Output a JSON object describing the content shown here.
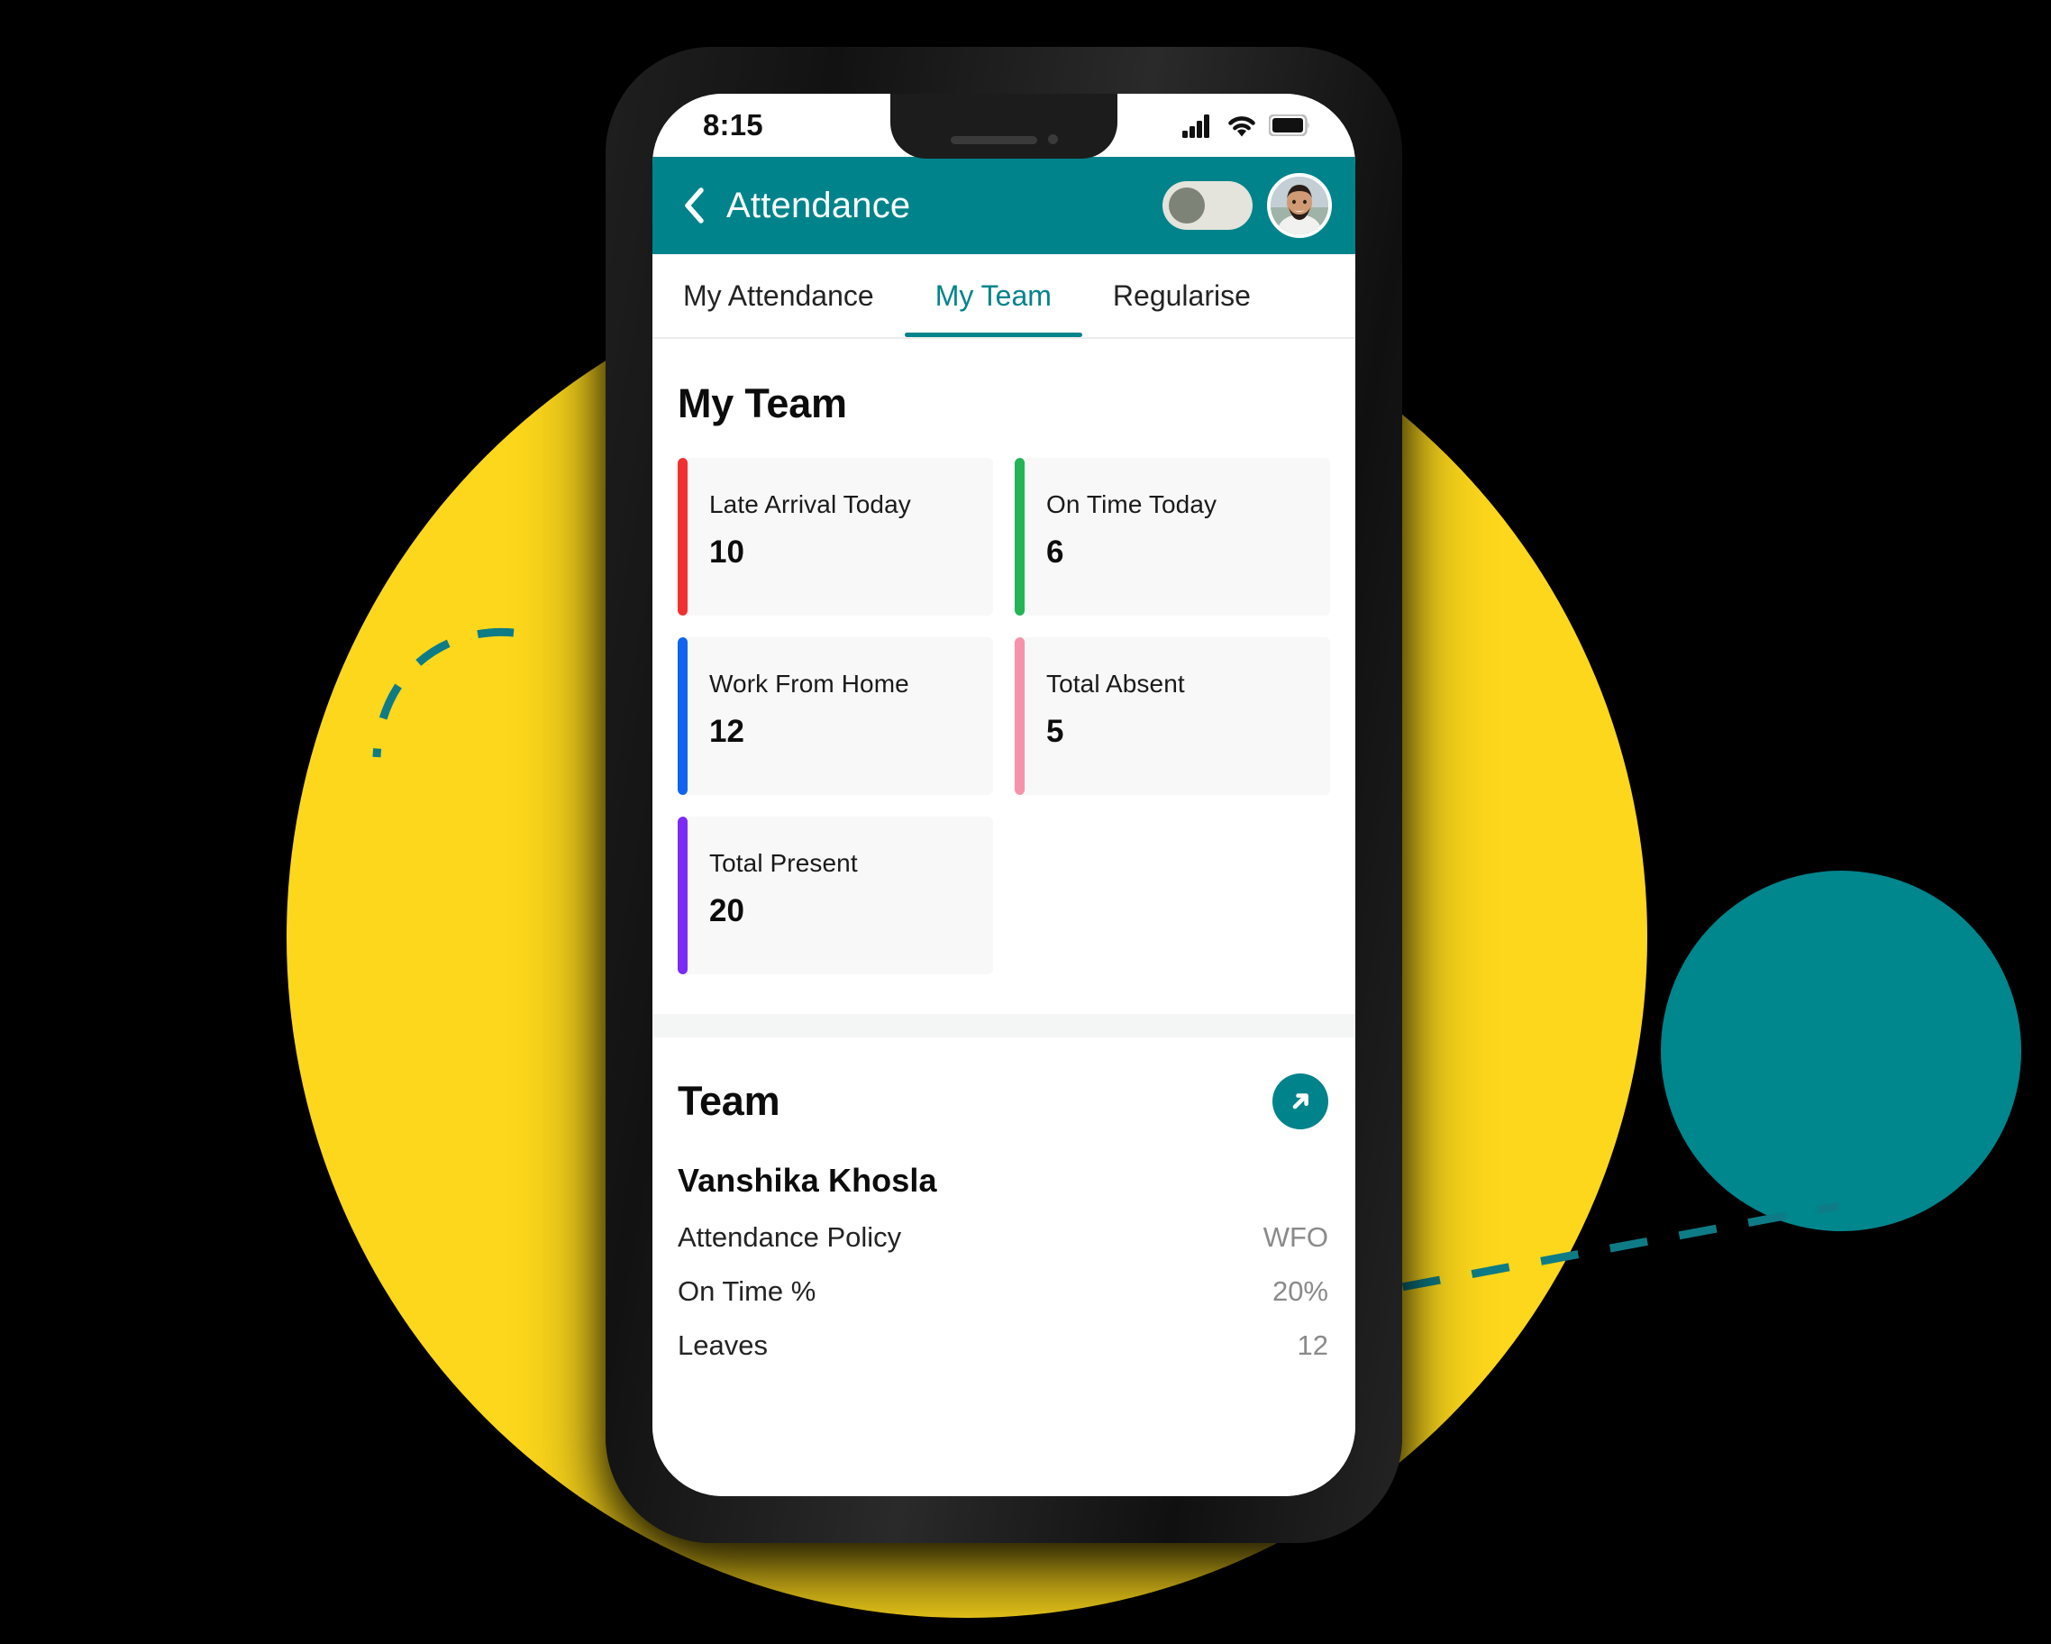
{
  "status_bar": {
    "time": "8:15",
    "signal_icon": "cellular-signal-icon",
    "wifi_icon": "wifi-icon",
    "battery_icon": "battery-full-icon"
  },
  "header": {
    "back_icon": "back-chevron-icon",
    "title": "Attendance",
    "toggle_state": "off",
    "avatar_alt": "user-avatar"
  },
  "tabs": [
    {
      "label": "My Attendance",
      "active": false
    },
    {
      "label": "My Team",
      "active": true
    },
    {
      "label": "Regularise",
      "active": false
    }
  ],
  "main": {
    "section_title": "My Team",
    "stats": [
      {
        "label": "Late Arrival Today",
        "value": "10",
        "accent": "#F03030"
      },
      {
        "label": "On Time Today",
        "value": "6",
        "accent": "#22B455"
      },
      {
        "label": "Work From Home",
        "value": "12",
        "accent": "#1064F0"
      },
      {
        "label": "Total Absent",
        "value": "5",
        "accent": "#F792AA"
      },
      {
        "label": "Total Present",
        "value": "20",
        "accent": "#7B2BF5"
      }
    ]
  },
  "team": {
    "title": "Team",
    "expand_icon": "arrow-up-right-icon",
    "member": {
      "name": "Vanshika Khosla",
      "rows": [
        {
          "key": "Attendance Policy",
          "value": "WFO"
        },
        {
          "key": "On Time %",
          "value": "20%"
        },
        {
          "key": "Leaves",
          "value": "12"
        }
      ]
    }
  },
  "decor": {
    "yellow_circle_color": "#FCD71B",
    "teal_circle_color": "#00868D",
    "dash_color": "#0E7C86",
    "brand_teal": "#00838A",
    "background_color": "#000000"
  }
}
